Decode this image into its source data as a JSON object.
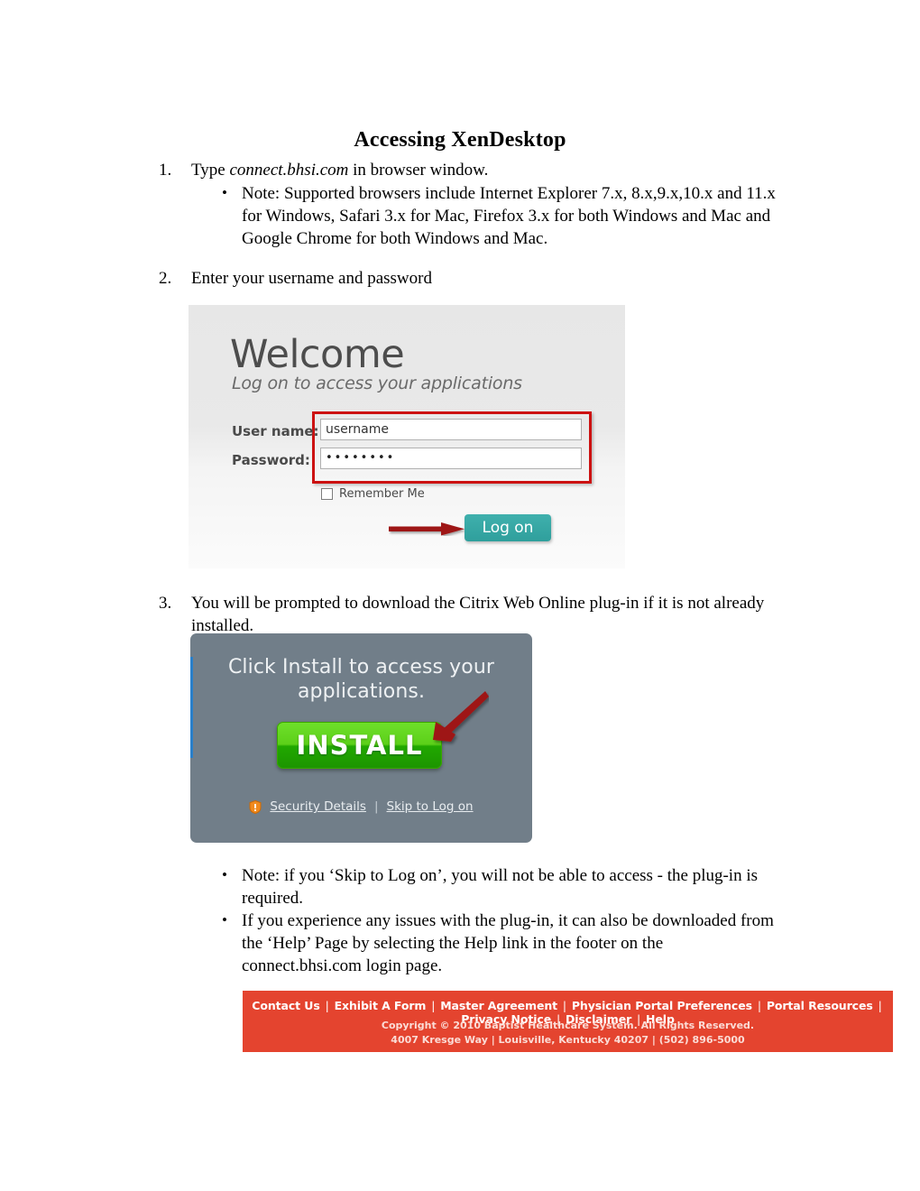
{
  "document": {
    "title": "Accessing XenDesktop"
  },
  "steps": [
    {
      "number": "1.",
      "text_before": "Type ",
      "text_italic": "connect.bhsi.com",
      "text_after": " in browser window.",
      "bullets": [
        "Note: Supported browsers include Internet Explorer 7.x, 8.x,9.x,10.x and 11.x  for Windows, Safari 3.x for Mac, Firefox 3.x for both Windows and Mac and Google Chrome for both Windows and Mac."
      ]
    },
    {
      "number": "2.",
      "text": "Enter your username and password"
    },
    {
      "number": "3.",
      "text": "You will be prompted to download the Citrix Web Online plug-in if it is not already installed.",
      "bullets": [
        "Note: if you ‘Skip to Log on’, you will not be able to access - the plug-in is required.",
        "If you experience any issues with the plug-in, it can also be downloaded from the ‘Help’ Page by selecting the Help link in the footer on the connect.bhsi.com login page."
      ]
    }
  ],
  "welcome_screenshot": {
    "heading": "Welcome",
    "subheading": "Log on to access your applications",
    "username_label": "User name:",
    "username_value": "username",
    "password_label": "Password:",
    "password_value": "••••••••",
    "remember_label": "Remember Me",
    "logon_button": "Log on",
    "accent_color": "#2f9f9c",
    "highlight_color": "#cc1111"
  },
  "install_screenshot": {
    "headline_line1": "Click Install to access your",
    "headline_line2": "applications.",
    "install_button": "INSTALL",
    "security_details_link": "Security Details",
    "separator": "|",
    "skip_link": "Skip to Log on",
    "button_color": "#3aa600",
    "dialog_color": "#717e89",
    "arrow_color": "#9e1515"
  },
  "footer_screenshot": {
    "links": [
      "Contact Us",
      "Exhibit A Form",
      "Master Agreement",
      "Physician Portal Preferences",
      "Portal Resources",
      "Privacy Notice",
      "Disclaimer",
      "Help"
    ],
    "separator": "|",
    "copyright": "Copyright © 2010 Baptist Healthcare System. All Rights Reserved.",
    "address": "4007 Kresge Way | Louisville, Kentucky 40207 | (502) 896-5000",
    "background_color": "#e4442f"
  }
}
